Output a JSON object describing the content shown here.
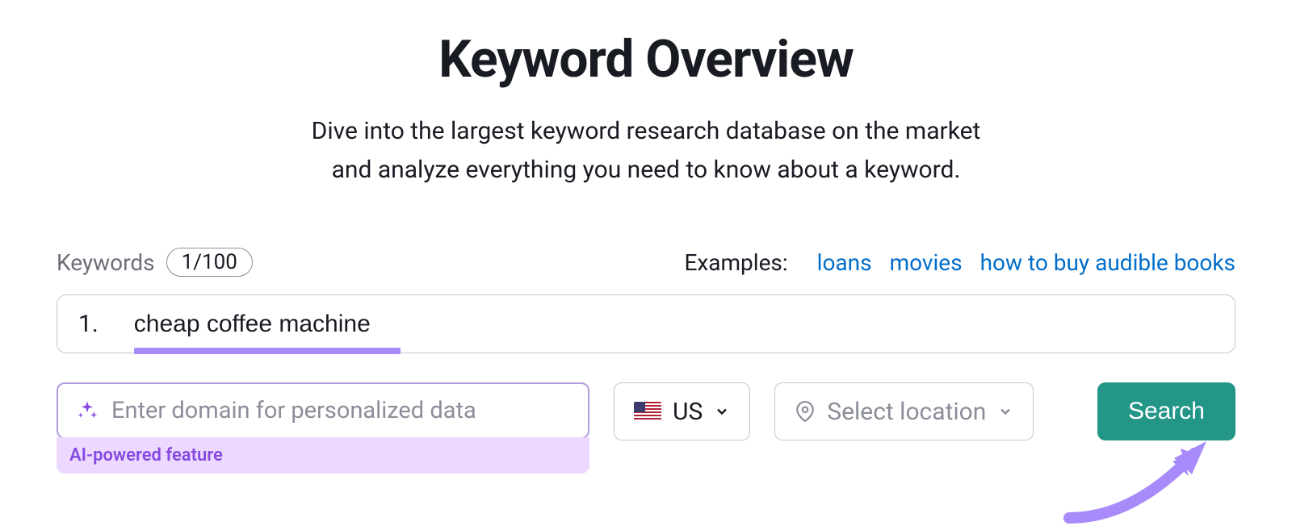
{
  "header": {
    "title": "Keyword Overview",
    "subtitle_line1": "Dive into the largest keyword research database on the market",
    "subtitle_line2": "and analyze everything you need to know about a keyword."
  },
  "keywords": {
    "label": "Keywords",
    "count_badge": "1/100",
    "examples_label": "Examples:",
    "examples": [
      "loans",
      "movies",
      "how to buy audible books"
    ],
    "row_number": "1.",
    "row_value": "cheap coffee machine"
  },
  "domain": {
    "placeholder": "Enter domain for personalized data",
    "ai_label": "AI-powered feature"
  },
  "country": {
    "code": "US"
  },
  "location": {
    "placeholder": "Select location"
  },
  "actions": {
    "search": "Search"
  }
}
